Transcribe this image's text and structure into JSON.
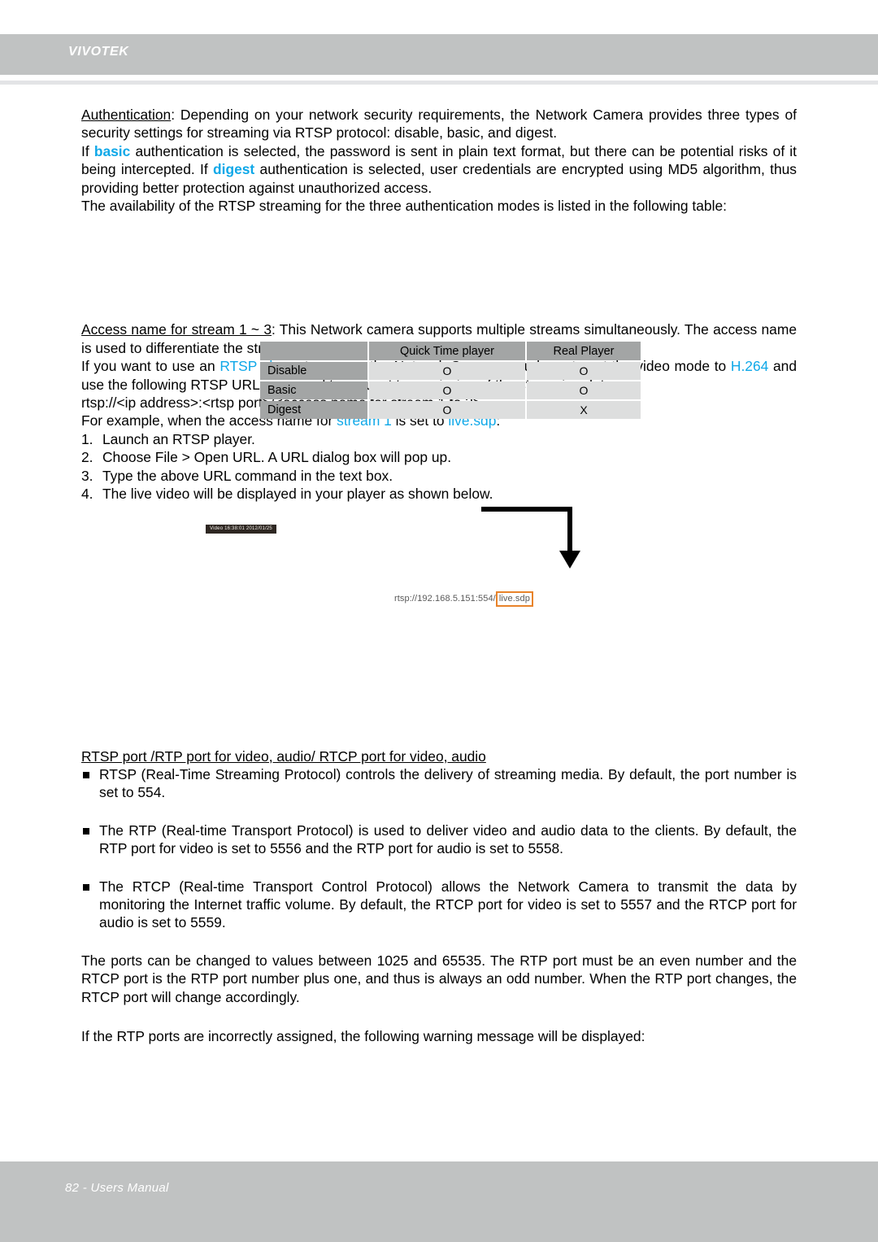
{
  "header": {
    "brand": "VIVOTEK"
  },
  "footer": {
    "page_label": "82 - Users Manual"
  },
  "colors": {
    "header_bg": "#c0c2c2",
    "accent_cyan": "#0fa8e8",
    "highlight_orange": "#e8832a",
    "table_header_bg": "#a3a5a5",
    "table_cell_bg": "#dddede"
  },
  "section_auth": {
    "term": "Authentication",
    "p1_a": ": Depending on your network security requirements, the Network Camera provides three types of security settings for streaming via RTSP protocol: disable, basic, and digest.",
    "p2_pre": "If ",
    "p2_basic": "basic",
    "p2_mid": " authentication is selected, the password is sent in plain text format, but there can be potential risks of it being intercepted. If ",
    "p2_digest": "digest",
    "p2_post": " authentication is selected, user credentials are encrypted using MD5 algorithm, thus providing better protection against unauthorized access.",
    "p3": "The availability of the RTSP streaming for the three authentication modes is listed in the following table:"
  },
  "availability_table": {
    "corner": "",
    "columns": [
      "Quick Time player",
      "Real Player"
    ],
    "rows": [
      {
        "label": "Disable",
        "values": [
          "O",
          "O"
        ]
      },
      {
        "label": "Basic",
        "values": [
          "O",
          "O"
        ]
      },
      {
        "label": "Digest",
        "values": [
          "O",
          "X"
        ]
      }
    ]
  },
  "section_access": {
    "term": "Access name for stream 1 ~ 3",
    "p1": ": This Network camera supports multiple streams simultaneously. The access name is used to differentiate the streaming source.",
    "p2_pre": "If you want to use an ",
    "p2_rtsp": "RTSP player",
    "p2_mid": " to access the Network Camera, you have to set the video mode to ",
    "p2_h264": "H.264",
    "p2_post": " and use the following RTSP URL command to request transmission of the streaming data.",
    "url_template": "rtsp://<ip address>:<rtsp port>/<access name for stream 1 to 3>",
    "example_pre": "For example, when the access name for ",
    "example_stream": "stream 1",
    "example_mid": " is set to ",
    "example_value": "live.sdp",
    "example_post": ":",
    "steps": [
      {
        "num": "1.",
        "text": "Launch an RTSP player."
      },
      {
        "num": "2.",
        "text": "Choose File > Open URL. A URL dialog box will pop up."
      },
      {
        "num": "3.",
        "text": "Type the above URL command in the text box."
      },
      {
        "num": "4.",
        "text": "The live video will be displayed in your player as shown below."
      }
    ]
  },
  "figure": {
    "video_badge": "Video 16:38:01 2012/01/25",
    "url_prefix": "rtsp://192.168.5.151:554/",
    "url_highlight": "live.sdp"
  },
  "section_ports": {
    "heading": "RTSP port /RTP port for video, audio/ RTCP port for video, audio",
    "bullets": [
      "RTSP (Real-Time Streaming Protocol) controls the delivery of streaming media. By default, the port number is set to 554.",
      "The RTP (Real-time Transport Protocol) is used to deliver video and audio data to the clients. By default, the RTP port for video is set to 5556 and the RTP port for audio is set to 5558.",
      "The RTCP (Real-time Transport Control Protocol) allows the Network Camera to transmit the data by monitoring the Internet traffic volume. By default, the RTCP port for video is set to 5557 and the RTCP port for audio is set to 5559."
    ],
    "p_range": "The ports can be changed to values between 1025 and 65535. The RTP port must be an even number and the RTCP port is the RTP port number plus one, and thus is always an odd number. When the RTP port changes, the RTCP port will change accordingly.",
    "p_warning": "If the RTP ports are incorrectly assigned, the following warning message will be displayed:"
  }
}
